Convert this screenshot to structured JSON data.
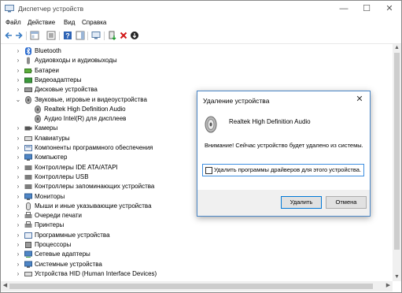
{
  "window": {
    "title": "Диспетчер устройств",
    "minimize": "—",
    "maximize": "☐",
    "close": "✕"
  },
  "menu": [
    "Файл",
    "Действие",
    "Вид",
    "Справка"
  ],
  "tree": [
    {
      "label": "Bluetooth",
      "expanded": false,
      "level": 0,
      "icon": "bluetooth-icon"
    },
    {
      "label": "Аудиовходы и аудиовыходы",
      "expanded": false,
      "level": 0,
      "icon": "audio-io-icon"
    },
    {
      "label": "Батареи",
      "expanded": false,
      "level": 0,
      "icon": "battery-icon"
    },
    {
      "label": "Видеоадаптеры",
      "expanded": false,
      "level": 0,
      "icon": "display-adapter-icon"
    },
    {
      "label": "Дисковые устройства",
      "expanded": false,
      "level": 0,
      "icon": "disk-drive-icon"
    },
    {
      "label": "Звуковые, игровые и видеоустройства",
      "expanded": true,
      "level": 0,
      "icon": "sound-icon"
    },
    {
      "label": "Realtek High Definition Audio",
      "level": 1,
      "icon": "speaker-icon"
    },
    {
      "label": "Аудио Intel(R) для дисплеев",
      "level": 1,
      "icon": "speaker-icon"
    },
    {
      "label": "Камеры",
      "expanded": false,
      "level": 0,
      "icon": "camera-icon"
    },
    {
      "label": "Клавиатуры",
      "expanded": false,
      "level": 0,
      "icon": "keyboard-icon"
    },
    {
      "label": "Компоненты программного обеспечения",
      "expanded": false,
      "level": 0,
      "icon": "software-component-icon"
    },
    {
      "label": "Компьютер",
      "expanded": false,
      "level": 0,
      "icon": "computer-icon"
    },
    {
      "label": "Контроллеры IDE ATA/ATAPI",
      "expanded": false,
      "level": 0,
      "icon": "ide-controller-icon"
    },
    {
      "label": "Контроллеры USB",
      "expanded": false,
      "level": 0,
      "icon": "usb-controller-icon"
    },
    {
      "label": "Контроллеры запоминающих устройства",
      "expanded": false,
      "level": 0,
      "icon": "storage-controller-icon"
    },
    {
      "label": "Мониторы",
      "expanded": false,
      "level": 0,
      "icon": "monitor-icon"
    },
    {
      "label": "Мыши и иные указывающие устройства",
      "expanded": false,
      "level": 0,
      "icon": "mouse-icon"
    },
    {
      "label": "Очереди печати",
      "expanded": false,
      "level": 0,
      "icon": "print-queue-icon"
    },
    {
      "label": "Принтеры",
      "expanded": false,
      "level": 0,
      "icon": "printer-icon"
    },
    {
      "label": "Программные устройства",
      "expanded": false,
      "level": 0,
      "icon": "software-device-icon"
    },
    {
      "label": "Процессоры",
      "expanded": false,
      "level": 0,
      "icon": "processor-icon"
    },
    {
      "label": "Сетевые адаптеры",
      "expanded": false,
      "level": 0,
      "icon": "network-adapter-icon"
    },
    {
      "label": "Системные устройства",
      "expanded": false,
      "level": 0,
      "icon": "system-device-icon"
    },
    {
      "label": "Устройства HID (Human Interface Devices)",
      "expanded": false,
      "level": 0,
      "icon": "hid-icon"
    }
  ],
  "dialog": {
    "title": "Удаление устройства",
    "close": "✕",
    "device_name": "Realtek High Definition Audio",
    "warning": "Внимание! Сейчас устройство будет удалено из системы.",
    "checkbox_label": "Удалить программы драйверов для этого устройства.",
    "checkbox_checked": false,
    "ok_label": "Удалить",
    "cancel_label": "Отмена"
  }
}
